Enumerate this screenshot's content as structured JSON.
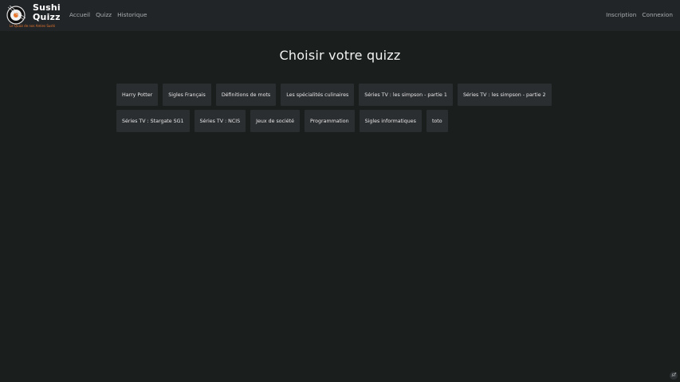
{
  "brand": {
    "title_line1": "Sushi",
    "title_line2": "Quizz",
    "tagline": "Le Quizz de nos Amies Sushi"
  },
  "nav": {
    "left": [
      "Accueil",
      "Quizz",
      "Historique"
    ],
    "right": [
      "Inscription",
      "Connexion"
    ]
  },
  "main": {
    "title": "Choisir votre quizz",
    "quizzes_row1": [
      "Harry Potter",
      "Sigles Français",
      "Définitions de mots",
      "Les spécialités culinaires",
      "Séries TV : les simpson - partie 1",
      "Séries TV : les simpson - partie 2"
    ],
    "quizzes_row2": [
      "Séries TV : Stargate SG1",
      "Séries TV : NCIS",
      "Jeux de société",
      "Programmation",
      "Sigles informatiques",
      "toto"
    ]
  },
  "debug": {
    "icon": "symfony-icon",
    "label": "sf"
  },
  "colors": {
    "background": "#1a1f1e",
    "navbar": "#222528",
    "button": "#2b2e31",
    "accent": "#e8772e"
  }
}
